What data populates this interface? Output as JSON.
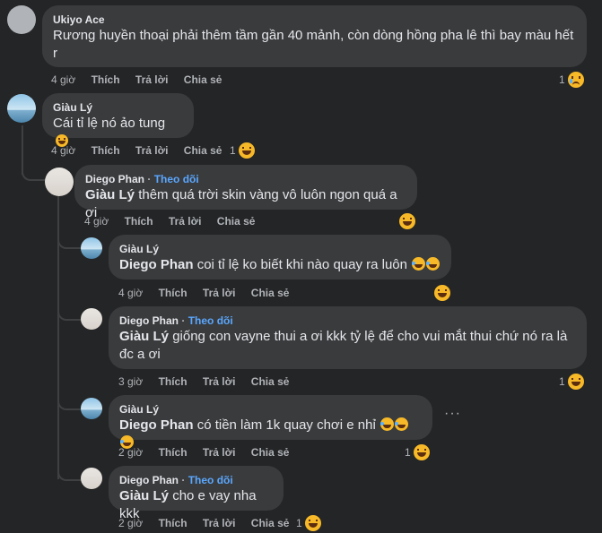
{
  "actions": {
    "like": "Thích",
    "reply": "Trả lời",
    "share": "Chia sẻ"
  },
  "follow_label": "Theo dõi",
  "separator": "·",
  "more_label": "···",
  "comments": [
    {
      "author": "Ukiyo Ace",
      "text": "Rương huyền thoại phải thêm tầm gần 40 mảnh, còn dòng hồng pha lê thì bay màu hết r",
      "time": "4 giờ",
      "reaction_count": "1",
      "reaction": "sad-emoji"
    },
    {
      "author": "Giàu Lý",
      "text": "Cái tỉ lệ nó ảo tung",
      "time": "4 giờ",
      "reaction_count": "1",
      "reaction": "haha-emoji"
    },
    {
      "author": "Diego Phan",
      "mention": "Giàu Lý",
      "text": "thêm quá trời skin vàng vô luôn ngon quá a ơi",
      "time": "4 giờ",
      "reaction_count": "",
      "reaction": "haha-emoji"
    },
    {
      "author": "Giàu Lý",
      "mention": "Diego Phan",
      "text": "coi tỉ lệ ko biết khi nào quay ra luôn",
      "time": "4 giờ",
      "reaction_count": "",
      "reaction": "haha-emoji"
    },
    {
      "author": "Diego Phan",
      "mention": "Giàu Lý",
      "text": "giống con vayne thui a ơi kkk tỷ lệ để cho vui mắt thui chứ nó ra là đc a ơi",
      "time": "3 giờ",
      "reaction_count": "1",
      "reaction": "haha-emoji"
    },
    {
      "author": "Giàu Lý",
      "mention": "Diego Phan",
      "text": "có tiền làm 1k quay chơi e nhỉ",
      "time": "2 giờ",
      "reaction_count": "1",
      "reaction": "haha-emoji"
    },
    {
      "author": "Diego Phan",
      "mention": "Giàu Lý",
      "text": "cho e vay nha kkk",
      "time": "2 giờ",
      "reaction_count": "1",
      "reaction": "haha-emoji"
    }
  ],
  "colors": {
    "background": "#242526",
    "bubble": "#3a3b3c",
    "link": "#5aa7ff",
    "meta": "#b0b3b8"
  }
}
